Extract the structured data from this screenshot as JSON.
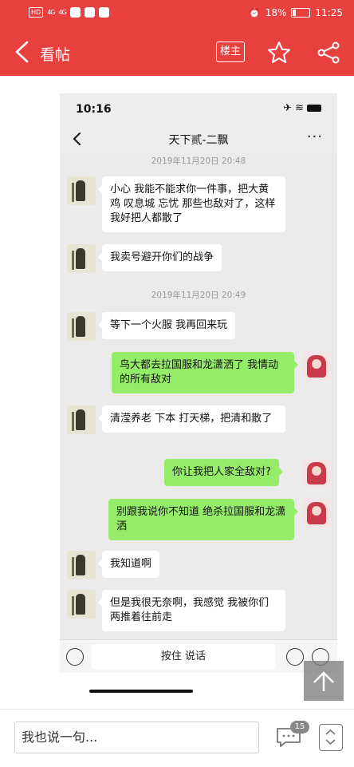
{
  "status_bar": {
    "hd": "HD",
    "signal_1": "4G",
    "signal_2": "4G",
    "alarm_icon": "alarm-icon",
    "battery_percent": "18%",
    "time": "11:25"
  },
  "header": {
    "title": "看帖",
    "owner_label": "楼主",
    "icons": {
      "back": "chevron-left-icon",
      "favorite": "star-icon",
      "share": "share-icon"
    }
  },
  "screenshot": {
    "ios_time": "10:16",
    "chat_title": "天下贰-二飘",
    "more": "···",
    "messages": [
      {
        "type": "timestamp",
        "text": "2019年11月20日 20:48"
      },
      {
        "type": "in",
        "text": "小心 我能不能求你一件事，把大黄鸡 叹息城 忘忧 那些也敌对了，这样我好把人都散了"
      },
      {
        "type": "in",
        "text": "我卖号避开你们的战争"
      },
      {
        "type": "timestamp",
        "text": "2019年11月20日 20:49"
      },
      {
        "type": "in",
        "text": "等下一个火服 我再回来玩"
      },
      {
        "type": "out",
        "text": "鸟大都去拉国服和龙潇洒了 我情动的所有敌对"
      },
      {
        "type": "in",
        "text": "清滢养老 下本 打天梯，把清和散了"
      },
      {
        "type": "out",
        "text": "你让我把人家全敌对?"
      },
      {
        "type": "out",
        "text": "别跟我说你不知道 绝杀拉国服和龙潇洒"
      },
      {
        "type": "in",
        "text": "我知道啊"
      },
      {
        "type": "in",
        "text": "但是我很无奈啊，我感觉 我被你们两推着往前走"
      }
    ],
    "input_label": "按住 说话"
  },
  "bottom_bar": {
    "comment_placeholder": "我也说一句...",
    "comment_count": "15"
  },
  "colors": {
    "header_red": "#e8403f",
    "bubble_green": "#95ec69",
    "bubble_white": "#ffffff"
  }
}
